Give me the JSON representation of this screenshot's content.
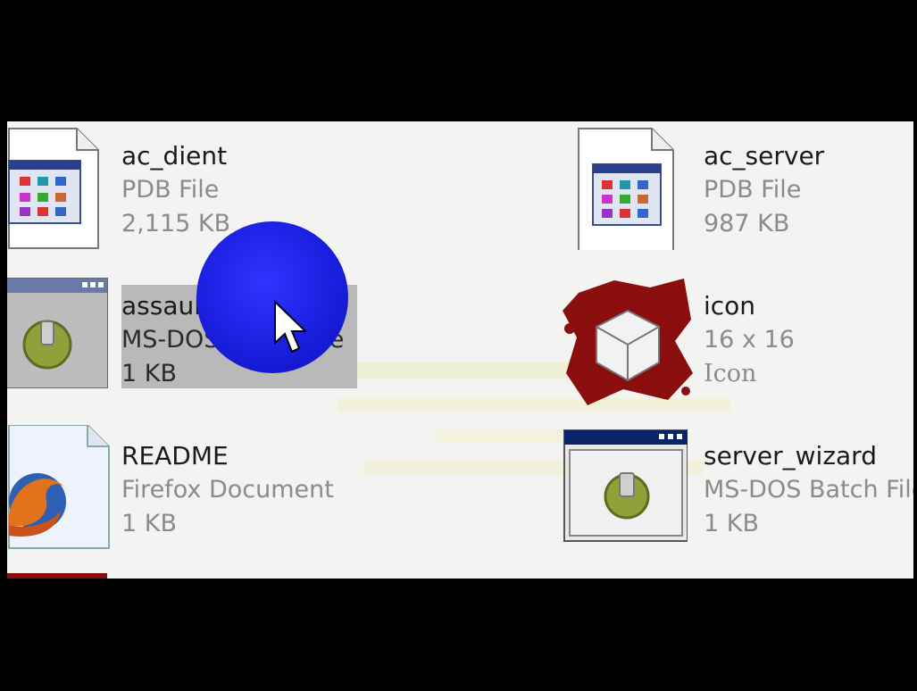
{
  "files": [
    {
      "name": "ac_dient",
      "type": "PDB File",
      "size": "2,115 KB",
      "icon": "pdb-file-icon"
    },
    {
      "name": "ac_server",
      "type": "PDB File",
      "size": "987 KB",
      "icon": "pdb-file-icon"
    },
    {
      "name": "assaultcube",
      "type": "MS-DOS Batch File",
      "size": "1 KB",
      "icon": "batch-file-icon",
      "selected": true
    },
    {
      "name": "icon",
      "type": "16 x 16",
      "size": "Icon",
      "icon": "splatter-cube-icon"
    },
    {
      "name": "README",
      "type": "Firefox Document",
      "size": "1 KB",
      "icon": "firefox-document-icon"
    },
    {
      "name": "server_wizard",
      "type": "MS-DOS Batch File",
      "size": "1 KB",
      "icon": "batch-file-icon"
    }
  ],
  "colors": {
    "background": "#f3f3f1",
    "selection": "#b9b9b9",
    "cursor_halo": "#1a1fe0",
    "meta_text": "#8b8b8b",
    "window_titlebar": "#0a246a"
  }
}
